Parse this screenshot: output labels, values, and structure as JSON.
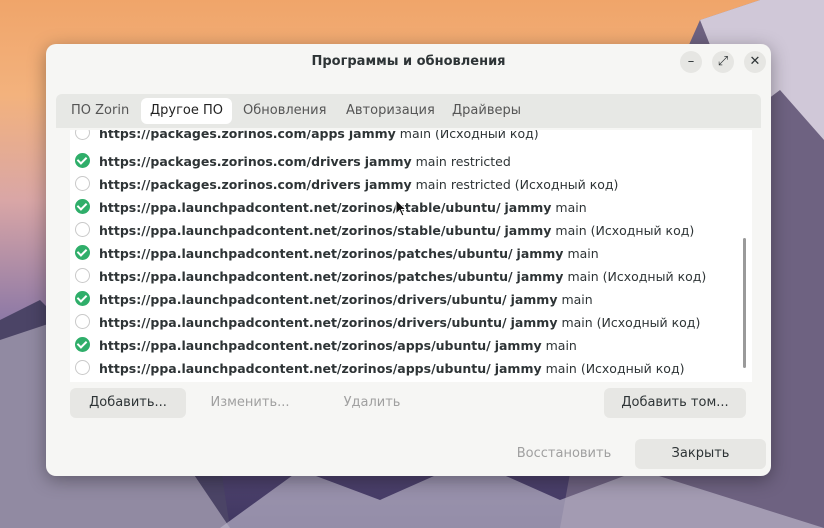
{
  "window": {
    "title": "Программы и обновления",
    "controls": [
      "–",
      "⤢",
      "✕"
    ]
  },
  "tabs": [
    {
      "label": "ПО Zorin",
      "active": false
    },
    {
      "label": "Другое ПО",
      "active": true
    },
    {
      "label": "Обновления",
      "active": false
    },
    {
      "label": "Авторизация",
      "active": false
    },
    {
      "label": "Драйверы",
      "active": false
    }
  ],
  "sources": [
    {
      "checked": false,
      "url": "https://packages.zorinos.com/apps",
      "suite": "jammy",
      "components": "main (Исходный код)"
    },
    {
      "checked": true,
      "url": "https://packages.zorinos.com/drivers",
      "suite": "jammy",
      "components": "main restricted"
    },
    {
      "checked": false,
      "url": "https://packages.zorinos.com/drivers",
      "suite": "jammy",
      "components": "main restricted (Исходный код)"
    },
    {
      "checked": true,
      "url": "https://ppa.launchpadcontent.net/zorinos/stable/ubuntu/",
      "suite": "jammy",
      "components": "main"
    },
    {
      "checked": false,
      "url": "https://ppa.launchpadcontent.net/zorinos/stable/ubuntu/",
      "suite": "jammy",
      "components": "main (Исходный код)"
    },
    {
      "checked": true,
      "url": "https://ppa.launchpadcontent.net/zorinos/patches/ubuntu/",
      "suite": "jammy",
      "components": "main"
    },
    {
      "checked": false,
      "url": "https://ppa.launchpadcontent.net/zorinos/patches/ubuntu/",
      "suite": "jammy",
      "components": "main (Исходный код)"
    },
    {
      "checked": true,
      "url": "https://ppa.launchpadcontent.net/zorinos/drivers/ubuntu/",
      "suite": "jammy",
      "components": "main"
    },
    {
      "checked": false,
      "url": "https://ppa.launchpadcontent.net/zorinos/drivers/ubuntu/",
      "suite": "jammy",
      "components": "main (Исходный код)"
    },
    {
      "checked": true,
      "url": "https://ppa.launchpadcontent.net/zorinos/apps/ubuntu/",
      "suite": "jammy",
      "components": "main"
    },
    {
      "checked": false,
      "url": "https://ppa.launchpadcontent.net/zorinos/apps/ubuntu/",
      "suite": "jammy",
      "components": "main (Исходный код)"
    }
  ],
  "actions": {
    "add": "Добавить...",
    "edit": "Изменить...",
    "remove": "Удалить",
    "add_volume": "Добавить том..."
  },
  "footer": {
    "revert": "Восстановить",
    "close": "Закрыть"
  },
  "colors": {
    "check_on": "#2fae6a",
    "window_bg": "#f6f6f4"
  }
}
